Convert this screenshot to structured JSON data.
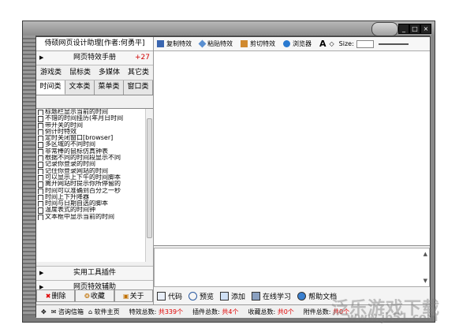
{
  "window": {
    "controls": [
      "_",
      "□",
      "×"
    ]
  },
  "left_panel": {
    "title": "侍硕网页设计助理[作者:何勇平]",
    "sections": {
      "effects": {
        "label": "网页特效手册",
        "badge": "+27"
      },
      "tools": {
        "label": "实用工具插件"
      },
      "helper": {
        "label": "网页特效辅助"
      }
    },
    "categories": [
      "游戏类",
      "鼠标类",
      "多媒体",
      "其它类"
    ],
    "tabs": [
      "时间类",
      "文本类",
      "菜单类",
      "窗口类"
    ],
    "active_tab": "时间类",
    "items": [
      "标题栏显示当前的时间",
      "不错的时间挂历(年月日时间",
      "带开关的时间",
      "倒计时特效",
      "定时关闭窗口[browser]",
      "多区域的不同时间",
      "非常棒的鼠标仿真钟表",
      "根据不同的时间段显示不同",
      "记录你登录的时间",
      "记住你登录网站的时间",
      "可以显示上下午的时间脚本",
      "离开网站时提示你所停留的",
      "时间可以准确到百分之一秒",
      "时间上下升降器",
      "时间与日期自选的脚本",
      "温度表式的时间钟",
      "文本框中显示当前的时间"
    ],
    "buttons": {
      "delete": "删除",
      "favorite": "收藏",
      "about": "关于"
    }
  },
  "toolbar": {
    "copy": "复制特效",
    "paste": "粘贴特效",
    "cut": "剪切特效",
    "browser": "浏览器",
    "size_label": "Size:",
    "size_value": ""
  },
  "bottom_tabs": {
    "code": "代码",
    "preview": "预览",
    "add": "添加",
    "learn": "在线学习",
    "help": "帮助文档"
  },
  "statusbar": {
    "mail": "咨询信箱",
    "home": "软件主页",
    "effects_total_label": "特效总数:",
    "effects_total": "共339个",
    "plugins_total_label": "插件总数:",
    "plugins_total": "共4个",
    "favorites_total_label": "收藏总数:",
    "favorites_total": "共0个",
    "attachments_total_label": "附件总数:",
    "attachments_total": "共0个"
  },
  "watermark": {
    "line1": "泛乐游戏下载",
    "line2": "www.jb51.com"
  }
}
